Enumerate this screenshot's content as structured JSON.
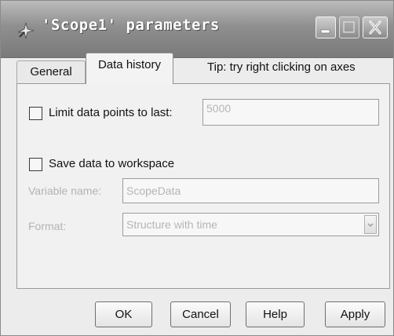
{
  "window": {
    "title": "'Scope1' parameters",
    "buttons": {
      "minimize": "minimize-icon",
      "maximize": "maximize-icon",
      "close": "close-icon"
    }
  },
  "tabs": [
    {
      "label": "General",
      "selected": false
    },
    {
      "label": "Data history",
      "selected": true
    }
  ],
  "tip": "Tip: try right clicking on axes",
  "limit_points": {
    "label": "Limit data points to last:",
    "checked": false,
    "value": "5000"
  },
  "save_workspace": {
    "label": "Save data to workspace",
    "checked": false
  },
  "variable_name": {
    "label": "Variable name:",
    "value": "ScopeData"
  },
  "format": {
    "label": "Format:",
    "value": "Structure with time"
  },
  "actions": {
    "ok": "OK",
    "cancel": "Cancel",
    "help": "Help",
    "apply": "Apply"
  }
}
